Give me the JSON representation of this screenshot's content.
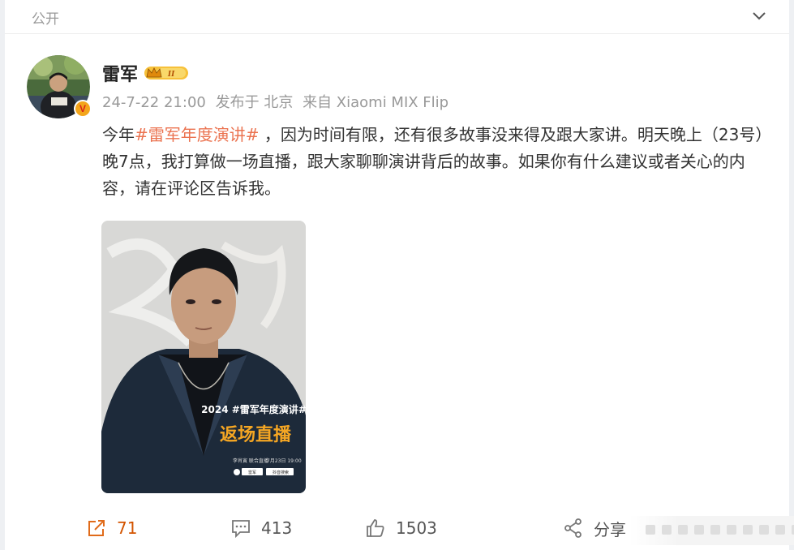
{
  "topbar": {
    "visibility_label": "公开"
  },
  "post": {
    "author": "雷军",
    "verified_badge": "V",
    "meta": {
      "time": "24-7-22 21:00",
      "location": "发布于 北京",
      "device": "来自 Xiaomi MIX Flip"
    },
    "text": {
      "prefix": "今年",
      "hashtag": "#雷军年度演讲#",
      "suffix": " ，因为时间有限，还有很多故事没来得及跟大家讲。明天晚上（23号）晚7点，我打算做一场直播，跟大家聊聊演讲背后的故事。如果你有什么建议或者关心的内容，请在评论区告诉我。"
    },
    "poster": {
      "headline": "2024 #雷军年度演讲#",
      "title": "返场直播",
      "line": "李肖寅  联合直播",
      "date": "7月23日 19:00",
      "platform_name": "雷军",
      "search_label": "抖音搜索"
    }
  },
  "actions": {
    "repost_count": "71",
    "comment_count": "413",
    "like_count": "1503",
    "share_label": "分享"
  },
  "colors": {
    "accent": "#eb7350",
    "badge": "#f3a51b",
    "poster_text": "#f5a623"
  }
}
